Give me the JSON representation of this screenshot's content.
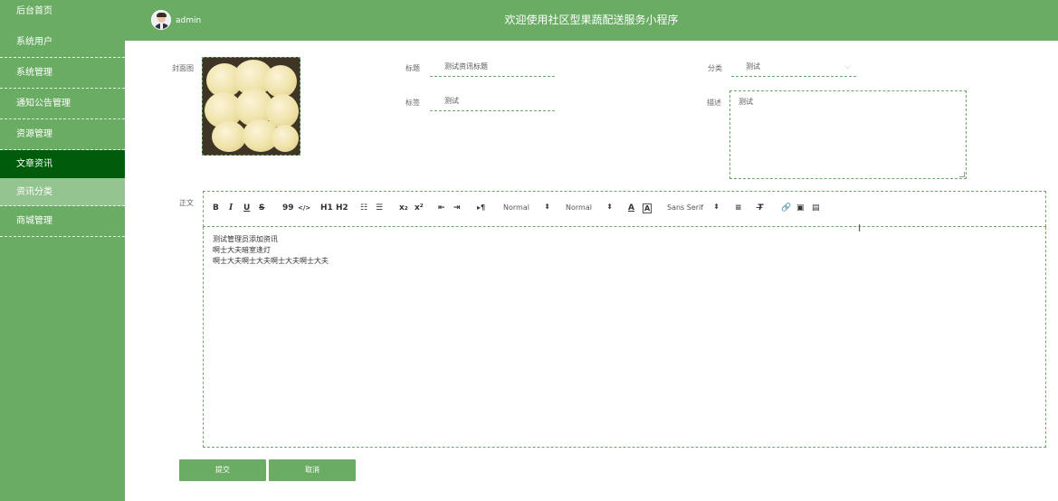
{
  "sidebar": {
    "items": [
      {
        "label": "后台首页"
      },
      {
        "label": "系统用户"
      },
      {
        "label": "系统管理"
      },
      {
        "label": "通知公告管理"
      },
      {
        "label": "资源管理"
      },
      {
        "label": "文章资讯"
      },
      {
        "label": "资讯分类"
      },
      {
        "label": "商城管理"
      }
    ]
  },
  "header": {
    "username": "admin",
    "site_title": "欢迎使用社区型果蔬配送服务小程序"
  },
  "form": {
    "cover_label": "封面图",
    "title_label": "标题",
    "title_value": "测试资讯标题",
    "category_label": "分类",
    "category_value": "测试",
    "tag_label": "标签",
    "tag_value": "测试",
    "desc_label": "描述",
    "desc_value": "测试",
    "body_label": "正文"
  },
  "toolbar": {
    "bold": "B",
    "italic": "I",
    "underline": "U",
    "strike": "S",
    "blockquote": "99",
    "code": "</>",
    "h1": "H1",
    "h2": "H2",
    "sub": "x₂",
    "sup": "x²",
    "direction": "▸¶",
    "size_value": "Normal",
    "header_value": "Normal",
    "font_value": "Sans Serif"
  },
  "editor": {
    "lines": [
      "测试管理员添加资讯",
      "啊士大夫暗室逢灯",
      "啊士大夫啊士大夫啊士大夫啊士大夫"
    ]
  },
  "buttons": {
    "submit": "提交",
    "cancel": "取消"
  }
}
